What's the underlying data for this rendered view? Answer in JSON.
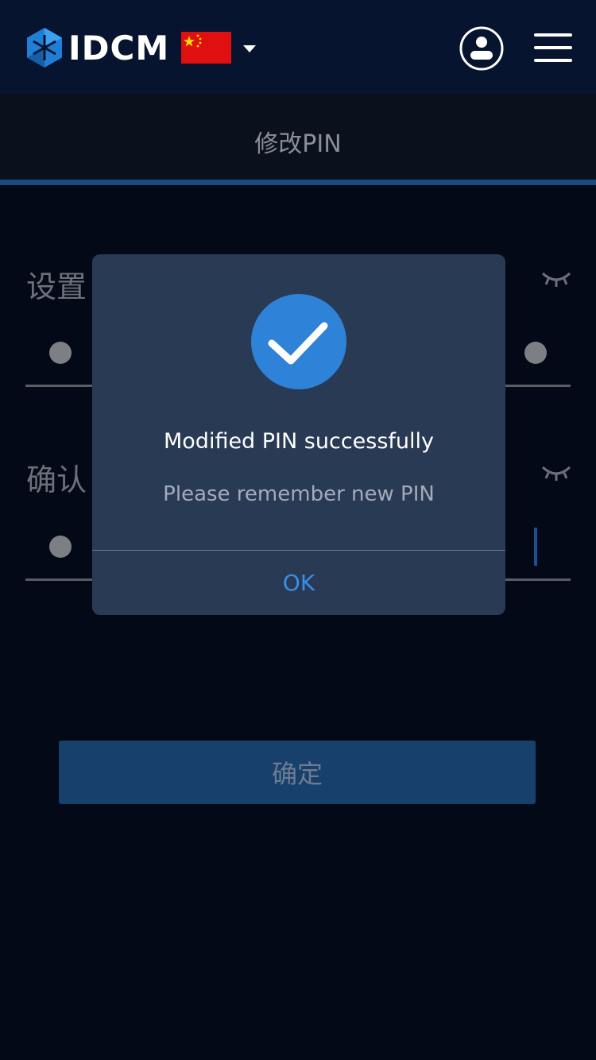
{
  "header": {
    "brand": "IDCM",
    "language_flag": "china-flag-icon",
    "icons": [
      "idcm-logo-icon",
      "caret-down-icon",
      "account-icon",
      "hamburger-menu-icon"
    ]
  },
  "page": {
    "title": "修改PIN"
  },
  "form": {
    "set_label": "设置",
    "confirm_label": "确认",
    "submit_label": "确定"
  },
  "dialog": {
    "icon": "checkmark-icon",
    "title": "Modified PIN successfully",
    "subtitle": "Please remember new PIN",
    "ok_label": "OK"
  },
  "colors": {
    "header_bg": "#06142f",
    "background": "#030916",
    "accent": "#2e82d8",
    "button": "#17406d",
    "dialog_bg": "#293a54",
    "ok_text": "#3a8ee6"
  }
}
